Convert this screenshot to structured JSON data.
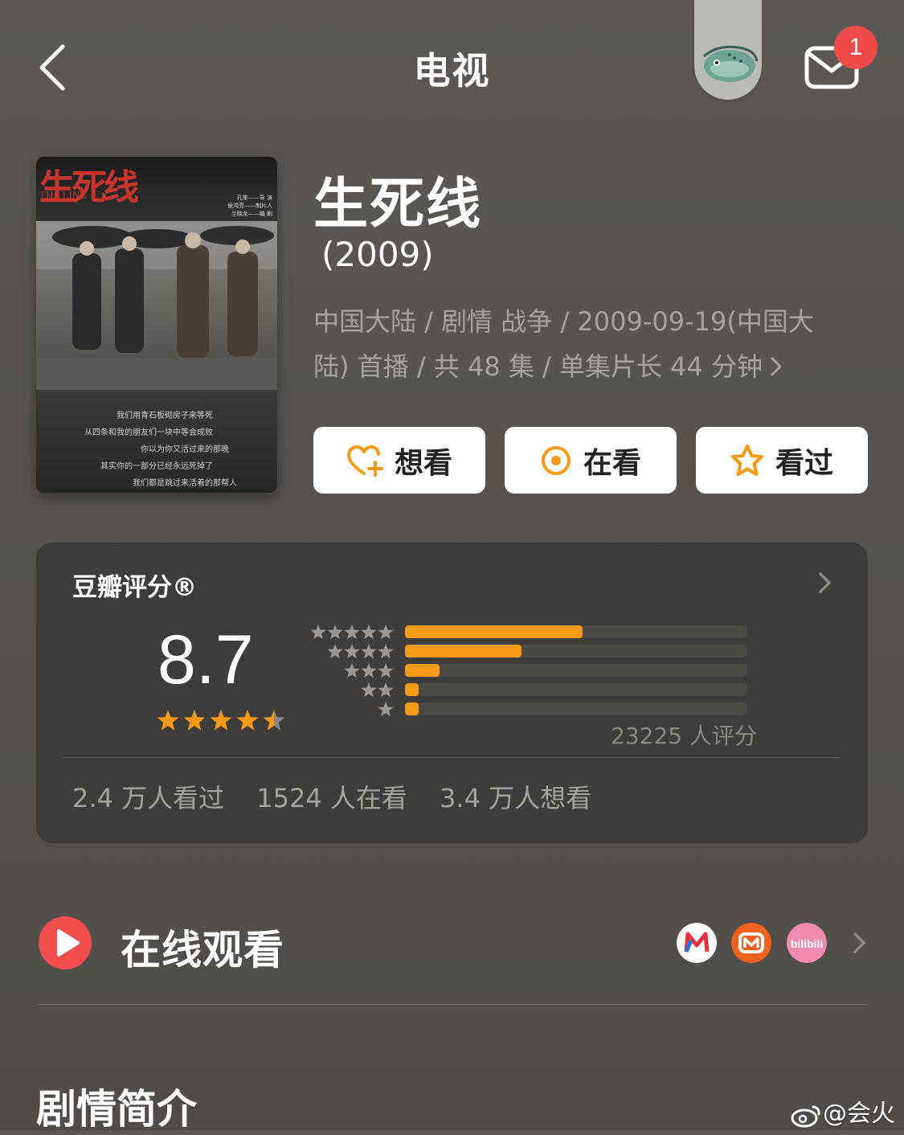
{
  "header": {
    "title": "电视",
    "notification_count": "1"
  },
  "poster": {
    "title_art": "生死线",
    "subtitle_art": "THE LINE",
    "credits": [
      "孔笙——导 演",
      "侯鸿亮——制片人",
      "兰晓龙——编 剧"
    ],
    "tagline_lines": [
      "我们用青石板砌房子来等死",
      "从四条和我的朋友们一块中等会成败",
      "你以为你又活过来的那晚",
      "其实你的一部分已经永远死掉了",
      "我们都是跳过来活着的那帮人"
    ]
  },
  "show": {
    "title": "生死线",
    "year": "(2009)",
    "meta_line1": "中国大陆 / 剧情 战争 / 2009-09-19(中国大",
    "meta_line2": "陆) 首播 / 共 48 集 / 单集片长 44 分钟"
  },
  "actions": {
    "want_label": "想看",
    "watching_label": "在看",
    "watched_label": "看过"
  },
  "rating": {
    "label": "豆瓣评分®",
    "score": "8.7",
    "stars": 4.5,
    "votes_text": "23225 人评分",
    "distribution_percent": [
      52,
      34,
      10,
      4,
      4
    ],
    "stats": [
      "2.4 万人看过",
      "1524 人在看",
      "3.4 万人想看"
    ]
  },
  "online": {
    "label": "在线观看",
    "platforms": [
      "mgtv-icon",
      "mangotv-icon",
      "bilibili-icon"
    ]
  },
  "synopsis": {
    "heading": "剧情简介"
  },
  "watermark": "@会火",
  "colors": {
    "accent": "#f79a17",
    "badge": "#f04a4a",
    "play": "#f24e4e"
  }
}
